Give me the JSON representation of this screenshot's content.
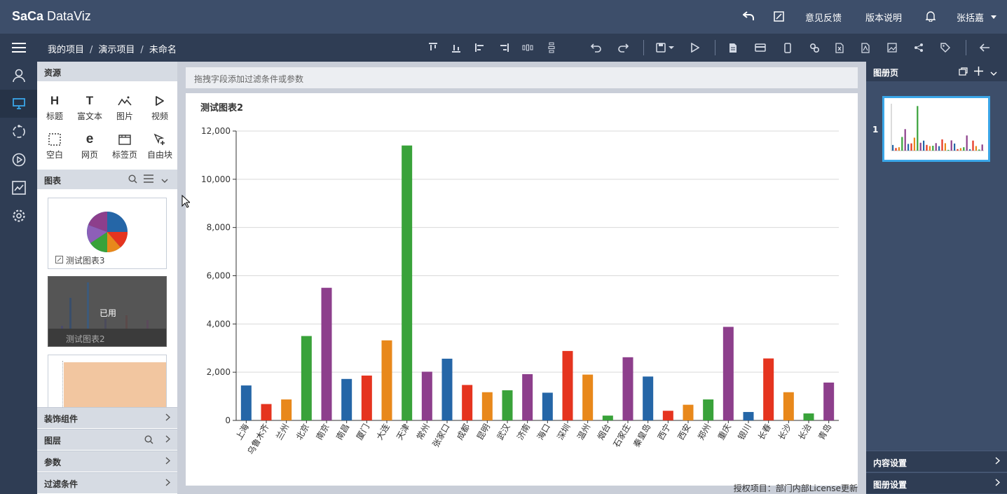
{
  "app": {
    "logo_prefix": "Sa",
    "logo_mark": "Ca",
    "logo_suffix": " DataViz"
  },
  "topbar": {
    "feedback": "意见反馈",
    "version": "版本说明",
    "user": "张括嘉",
    "icons": [
      "undo-arrow-icon",
      "edit-box-icon",
      "bell-icon",
      "caret-down-icon"
    ]
  },
  "breadcrumb": {
    "items": [
      "我的项目",
      "演示项目",
      "未命名"
    ],
    "separator": "/"
  },
  "toolbar": {
    "icons": [
      "align-top-icon",
      "align-bottom-icon",
      "align-left-icon",
      "align-right-icon",
      "distribute-horizontal-icon",
      "distribute-vertical-icon",
      "undo-icon",
      "redo-icon",
      "save-icon",
      "play-icon",
      "page-icon",
      "card-icon",
      "mobile-icon",
      "link-icon",
      "excel-icon",
      "pdf-icon",
      "image-icon",
      "share-icon",
      "tag-icon",
      "back-arrow-icon"
    ]
  },
  "leftnav": {
    "icons": [
      "menu-icon",
      "user-icon",
      "screen-icon",
      "refresh-circle-icon",
      "play-circle-icon",
      "line-chart-icon",
      "settings-icon"
    ],
    "active_index": 2
  },
  "panel": {
    "resources_title": "资源",
    "resources": [
      {
        "label": "标题",
        "icon": "H"
      },
      {
        "label": "富文本",
        "icon": "T"
      },
      {
        "label": "图片",
        "icon": "picture-icon"
      },
      {
        "label": "视频",
        "icon": "video-icon"
      },
      {
        "label": "空白",
        "icon": "blank-icon"
      },
      {
        "label": "网页",
        "icon": "e"
      },
      {
        "label": "标签页",
        "icon": "tabs-icon"
      },
      {
        "label": "自由块",
        "icon": "free-block-icon"
      }
    ],
    "charts_title": "图表",
    "chart_thumbs": [
      {
        "label": "测试图表3"
      },
      {
        "label": "测试图表2",
        "status": "已用"
      },
      {
        "label": ""
      }
    ],
    "sections": [
      "装饰组件",
      "图层",
      "参数",
      "过滤条件"
    ]
  },
  "main": {
    "filter_placeholder": "拖拽字段添加过滤条件或参数",
    "license_text": "授权项目：部门内部License更新"
  },
  "right": {
    "title": "图册页",
    "page_number": "1",
    "sections": [
      "内容设置",
      "图册设置"
    ]
  },
  "colors": {
    "topbar": "#3d4e6a",
    "accent": "#3aa6e8"
  },
  "chart_data": {
    "type": "bar",
    "title": "测试图表2",
    "xlabel": "",
    "ylabel": "",
    "ylim": [
      0,
      12000
    ],
    "yticks": [
      0,
      2000,
      4000,
      6000,
      8000,
      10000,
      12000
    ],
    "ytick_labels": [
      "0",
      "2,000",
      "4,000",
      "6,000",
      "8,000",
      "10,000",
      "12,000"
    ],
    "grid": true,
    "categories": [
      "上海",
      "乌鲁木齐",
      "兰州",
      "北京",
      "南京",
      "南昌",
      "厦门",
      "大连",
      "天津",
      "常州",
      "张家口",
      "成都",
      "昆明",
      "武汉",
      "济南",
      "海口",
      "深圳",
      "温州",
      "烟台",
      "石家庄",
      "秦皇岛",
      "西宁",
      "西安",
      "郑州",
      "重庆",
      "银川",
      "长春",
      "长沙",
      "长治",
      "青岛"
    ],
    "values": [
      1450,
      680,
      870,
      3500,
      5500,
      1720,
      1860,
      3320,
      11400,
      2020,
      2560,
      1470,
      1170,
      1250,
      1920,
      1150,
      2880,
      1900,
      200,
      2620,
      1820,
      400,
      650,
      870,
      3880,
      350,
      2570,
      1170,
      290,
      1570
    ],
    "bar_colors": [
      "#2566a7",
      "#e5341f",
      "#e8881b",
      "#39a23a",
      "#8d3f8c",
      "#2566a7",
      "#e5341f",
      "#e8881b",
      "#39a23a",
      "#8d3f8c",
      "#2566a7",
      "#e5341f",
      "#e8881b",
      "#39a23a",
      "#8d3f8c",
      "#2566a7",
      "#e5341f",
      "#e8881b",
      "#39a23a",
      "#8d3f8c",
      "#2566a7",
      "#e5341f",
      "#e8881b",
      "#39a23a",
      "#8d3f8c",
      "#2566a7",
      "#e5341f",
      "#e8881b",
      "#39a23a",
      "#8d3f8c"
    ]
  }
}
